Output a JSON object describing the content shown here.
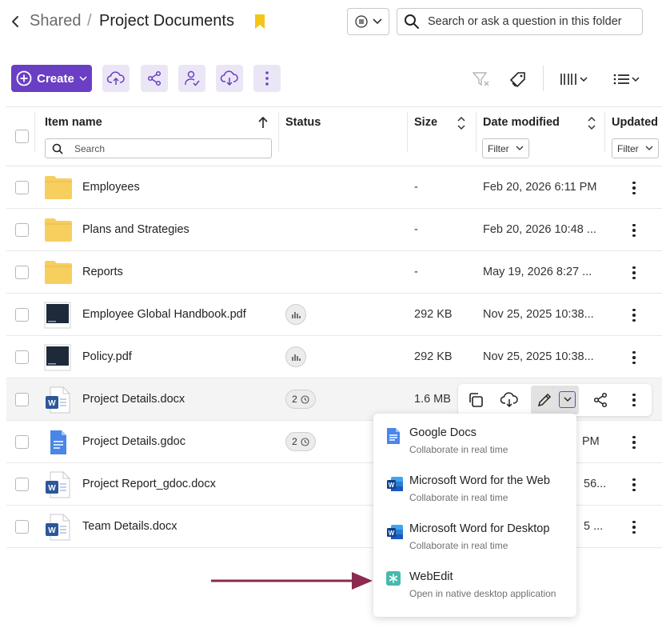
{
  "breadcrumb": {
    "parent": "Shared",
    "separator": "/",
    "current": "Project Documents"
  },
  "search": {
    "placeholder": "Search or ask a question in this folder"
  },
  "toolbar": {
    "create_label": "Create"
  },
  "table": {
    "headers": {
      "name": "Item name",
      "status": "Status",
      "size": "Size",
      "date": "Date modified",
      "updated": "Updated"
    },
    "name_search_placeholder": "Search",
    "filter_label": "Filter",
    "rows": [
      {
        "name": "Employees",
        "type": "folder",
        "size": "-",
        "date": "Feb 20, 2026 6:11 PM"
      },
      {
        "name": "Plans and Strategies",
        "type": "folder",
        "size": "-",
        "date": "Feb 20, 2026 10:48 ..."
      },
      {
        "name": "Reports",
        "type": "folder",
        "size": "-",
        "date": "May 19, 2026 8:27 ..."
      },
      {
        "name": "Employee Global Handbook.pdf",
        "type": "pdf",
        "size": "292 KB",
        "date": "Nov 25, 2025 10:38..."
      },
      {
        "name": "Policy.pdf",
        "type": "pdf",
        "size": "292 KB",
        "date": "Nov 25, 2025 10:38..."
      },
      {
        "name": "Project Details.docx",
        "type": "docx",
        "size": "1.6 MB",
        "date": "",
        "versions": "2"
      },
      {
        "name": "Project Details.gdoc",
        "type": "gdoc",
        "size": "",
        "date": "PM",
        "versions": "2"
      },
      {
        "name": "Project Report_gdoc.docx",
        "type": "docx",
        "size": "",
        "date": "56..."
      },
      {
        "name": "Team Details.docx",
        "type": "docx",
        "size": "",
        "date": "5 ..."
      }
    ]
  },
  "edit_menu": [
    {
      "title": "Google Docs",
      "subtitle": "Collaborate in real time",
      "icon": "google-docs-icon"
    },
    {
      "title": "Microsoft Word for the Web",
      "subtitle": "Collaborate in real time",
      "icon": "word-icon"
    },
    {
      "title": "Microsoft Word for Desktop",
      "subtitle": "Collaborate in real time",
      "icon": "word-icon"
    },
    {
      "title": "WebEdit",
      "subtitle": "Open in native desktop application",
      "icon": "webedit-icon"
    }
  ],
  "colors": {
    "accent": "#6a3fc4",
    "accent_light": "#ebe6f6",
    "folder": "#f6cf5f",
    "word": "#2b579a",
    "gdoc": "#4a86e8",
    "webedit": "#47b9ad",
    "annotation_arrow": "#8c2a4f",
    "bookmark": "#f5c518"
  }
}
